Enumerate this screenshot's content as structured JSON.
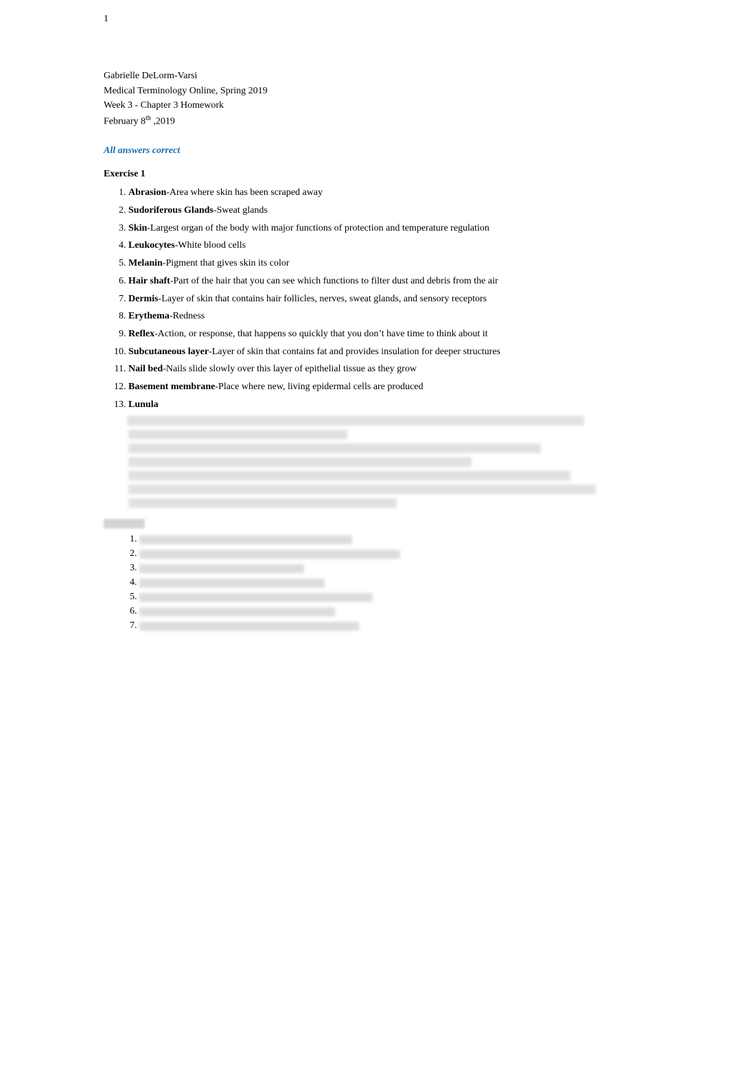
{
  "page": {
    "number": "1",
    "header": {
      "name": "Gabrielle DeLorm-Varsi",
      "course": "Medical Terminology Online, Spring 2019",
      "week": "Week 3 - Chapter 3 Homework",
      "date_text": "February 8",
      "date_sup": "th",
      "date_year": " ,2019"
    },
    "all_answers_label": "All answers correct",
    "exercise1_title": "Exercise 1",
    "items": [
      {
        "number": "1",
        "term": "Abrasion",
        "definition": "Area where skin has been scraped away"
      },
      {
        "number": "2",
        "term": "Sudoriferous Glands",
        "definition": "Sweat glands"
      },
      {
        "number": "3",
        "term": "Skin",
        "definition": "Largest organ of the body with major functions of protection and temperature regulation"
      },
      {
        "number": "4",
        "term": "Leukocytes",
        "definition": "White blood cells"
      },
      {
        "number": "5",
        "term": "Melanin",
        "definition": "Pigment that gives skin its color"
      },
      {
        "number": "6",
        "term": "Hair shaft",
        "definition": "Part of the hair that you can see which functions to filter dust and debris from the air"
      },
      {
        "number": "7",
        "term": "Dermis",
        "definition": "Layer of skin that contains hair follicles, nerves, sweat glands, and sensory receptors"
      },
      {
        "number": "8",
        "term": "Erythema",
        "definition": "Redness"
      },
      {
        "number": "9",
        "term": "Reflex",
        "definition": "Action, or response, that happens so quickly that you don’t have time to think about it"
      },
      {
        "number": "10",
        "term": "Subcutaneous layer",
        "definition": "Layer of skin that contains fat and provides insulation for deeper structures"
      },
      {
        "number": "11",
        "term": "Nail bed",
        "definition": "Nails slide slowly over this layer of epithelial tissue as they grow"
      },
      {
        "number": "12",
        "term": "Basement membrane",
        "definition": "Place where new, living epidermal cells are produced"
      },
      {
        "number": "13",
        "term": "Lunula",
        "definition": ""
      }
    ],
    "blurred_lines_after13": [
      {
        "width": "92%"
      },
      {
        "width": "45%"
      },
      {
        "width": "82%"
      },
      {
        "width": "70%"
      },
      {
        "width": "88%"
      },
      {
        "width": "94%"
      },
      {
        "width": "55%"
      }
    ],
    "section2_blurred_items": [
      {
        "width": "62%"
      },
      {
        "width": "78%"
      },
      {
        "width": "48%"
      },
      {
        "width": "55%"
      },
      {
        "width": "70%"
      },
      {
        "width": "58%"
      },
      {
        "width": "65%"
      }
    ]
  }
}
